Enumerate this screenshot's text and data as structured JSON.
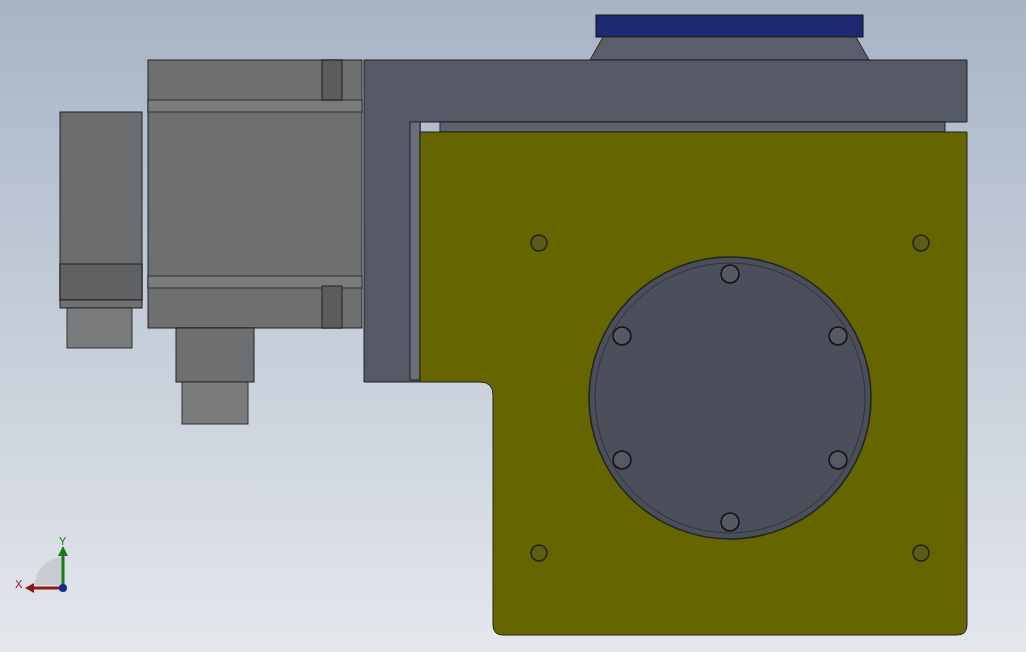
{
  "triad": {
    "x_label": "X",
    "y_label": "Y"
  }
}
